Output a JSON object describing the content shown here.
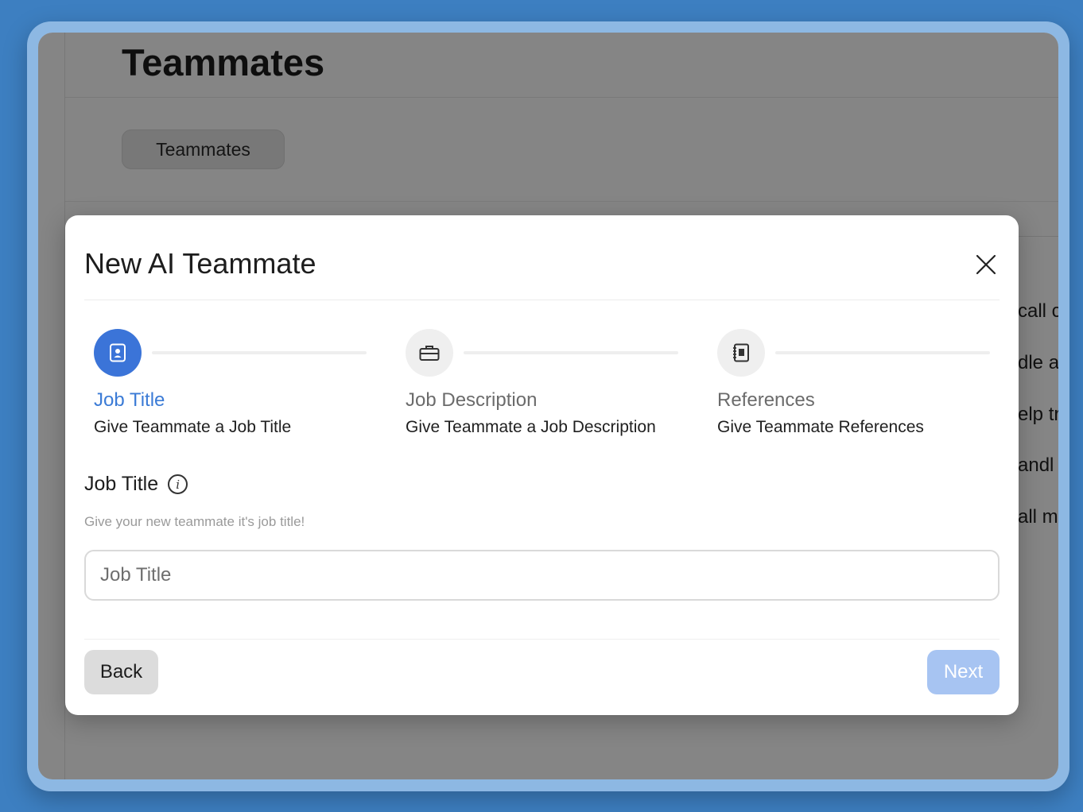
{
  "background": {
    "page_title": "Teammates",
    "tab_label": "Teammates",
    "snippets": [
      "call c",
      "dle al",
      "elp tr",
      "andl",
      "all m"
    ]
  },
  "modal": {
    "title": "New AI Teammate",
    "steps": [
      {
        "label": "Job Title",
        "subtitle": "Give Teammate a Job Title",
        "icon": "contact-badge-icon",
        "active": true
      },
      {
        "label": "Job Description",
        "subtitle": "Give Teammate a Job Description",
        "icon": "briefcase-icon",
        "active": false
      },
      {
        "label": "References",
        "subtitle": "Give Teammate References",
        "icon": "notebook-icon",
        "active": false
      }
    ],
    "field": {
      "label": "Job Title",
      "help": "Give your new teammate it's job title!",
      "placeholder": "Job Title",
      "value": ""
    },
    "back_label": "Back",
    "next_label": "Next"
  },
  "colors": {
    "accent": "#3b74d8",
    "next_disabled": "#a7c4f2",
    "frame": "#8db8e3",
    "desktop": "#3d7fc1"
  }
}
